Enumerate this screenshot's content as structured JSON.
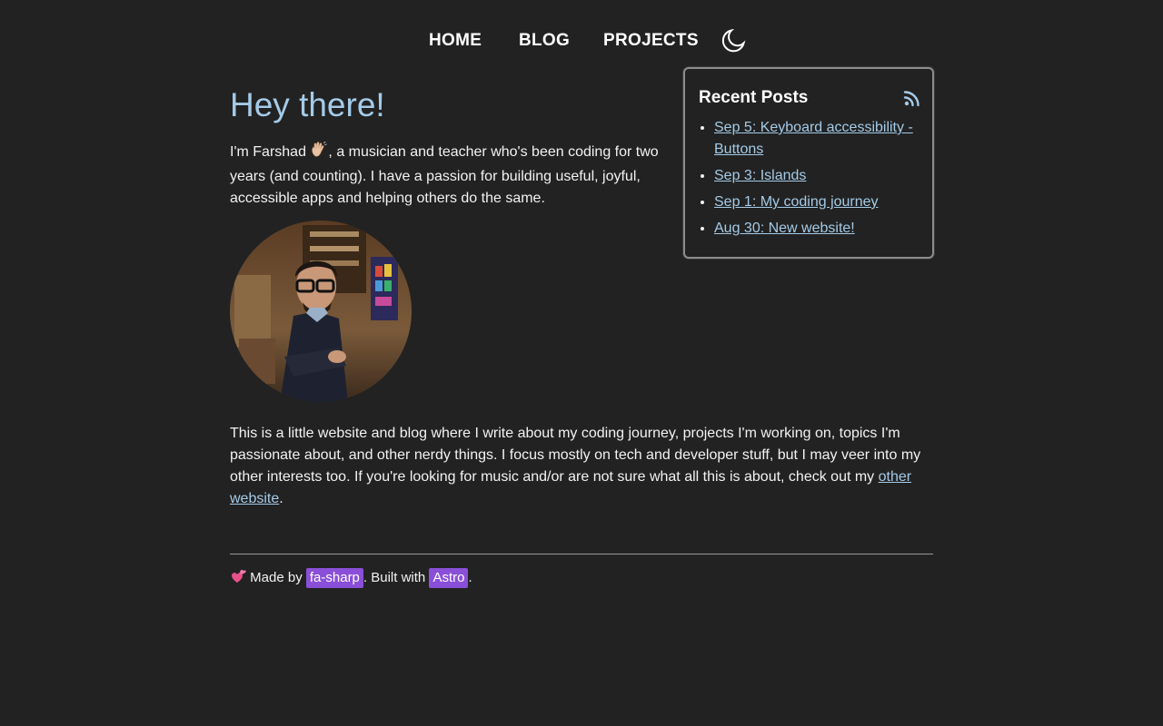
{
  "nav": {
    "home": "HOME",
    "blog": "BLOG",
    "projects": "PROJECTS",
    "theme_toggle_icon": "moon-icon"
  },
  "hero": {
    "greeting": "Hey there!",
    "intro_before_emoji": "I'm Farshad ",
    "intro_emoji_icon": "waving-hand-icon",
    "intro_after_emoji": ", a musician and teacher who's been coding for two years (and counting). I have a passion for building useful, joyful, accessible apps and helping others do the same."
  },
  "about": {
    "text": "This is a little website and blog where I write about my coding journey, projects I'm working on, topics I'm passionate about, and other nerdy things. I focus mostly on tech and developer stuff, but I may veer into my other interests too. If you're looking for music and/or are not sure what all this is about, check out my ",
    "link": "other website",
    "after": "."
  },
  "recent_posts": {
    "title": "Recent Posts",
    "icon": "rss-icon",
    "items": [
      "Sep 5: Keyboard accessibility - Buttons",
      "Sep 3: Islands",
      "Sep 1: My coding journey",
      "Aug 30: New website!"
    ]
  },
  "footer": {
    "emoji_icon": "two-hearts-icon",
    "made_by": " Made by ",
    "author": "fa-sharp",
    "built_with": ". Built with ",
    "framework": "Astro",
    "end": "."
  },
  "colors": {
    "background": "#222222",
    "link": "#a4cbe8",
    "heading_accent": "#a4cbe8",
    "tag_background": "#8a4fd8"
  }
}
